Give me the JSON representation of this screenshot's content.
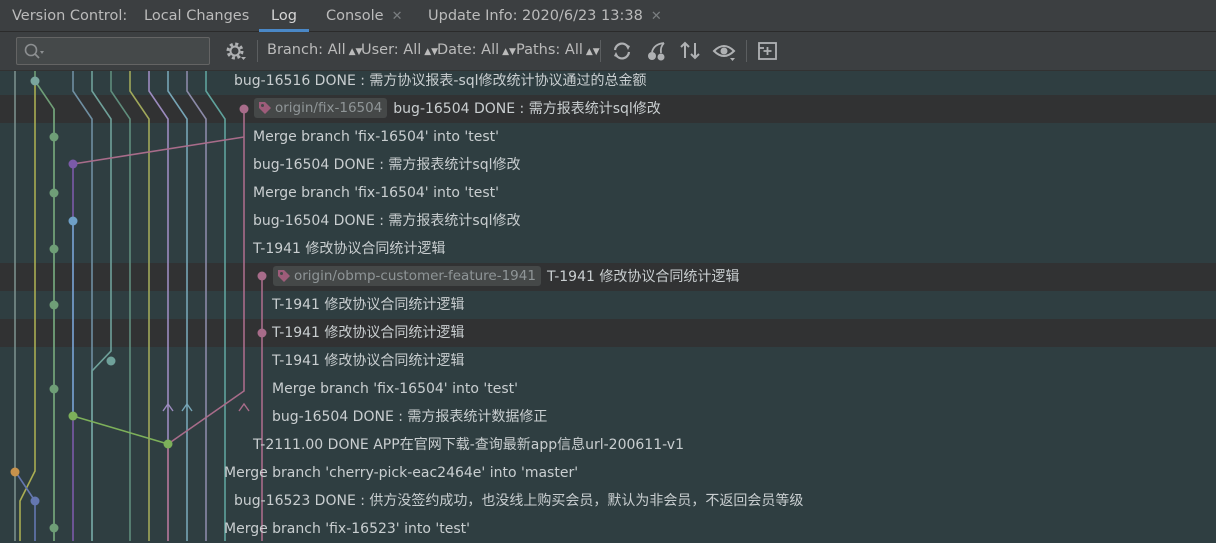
{
  "tabs": {
    "version_control": "Version Control:",
    "local_changes": "Local Changes",
    "log": "Log",
    "console": "Console",
    "update_info": "Update Info: 2020/6/23 13:38"
  },
  "toolbar": {
    "search_placeholder": "",
    "branch": "Branch: All",
    "user": "User: All",
    "date": "Date: All",
    "paths": "Paths: All"
  },
  "icons": [
    "search-icon",
    "settings-icon",
    "refresh-icon",
    "cherry-pick-icon",
    "sort-icon",
    "eye-icon",
    "new-tab-icon",
    "tag-icon"
  ],
  "colors": {
    "accent": "#4a88c7",
    "tag": "#9e5c7a"
  },
  "commits": [
    {
      "message": "bug-16516 DONE : 需方协议报表-sql修改统计协议通过的总金额",
      "ref": ""
    },
    {
      "message": "bug-16504 DONE : 需方报表统计sql修改",
      "ref": "origin/fix-16504"
    },
    {
      "message": "Merge branch 'fix-16504' into 'test'",
      "ref": ""
    },
    {
      "message": "bug-16504 DONE : 需方报表统计sql修改",
      "ref": ""
    },
    {
      "message": "Merge branch 'fix-16504' into 'test'",
      "ref": ""
    },
    {
      "message": "bug-16504 DONE : 需方报表统计sql修改",
      "ref": ""
    },
    {
      "message": "T-1941  修改协议合同统计逻辑",
      "ref": ""
    },
    {
      "message": "T-1941  修改协议合同统计逻辑",
      "ref": "origin/obmp-customer-feature-1941"
    },
    {
      "message": "T-1941  修改协议合同统计逻辑",
      "ref": ""
    },
    {
      "message": "T-1941  修改协议合同统计逻辑",
      "ref": ""
    },
    {
      "message": "T-1941  修改协议合同统计逻辑",
      "ref": ""
    },
    {
      "message": "Merge branch 'fix-16504' into 'test'",
      "ref": ""
    },
    {
      "message": "bug-16504 DONE : 需方报表统计数据修正",
      "ref": ""
    },
    {
      "message": "T-2111.00 DONE  APP在官网下载-查询最新app信息url-200611-v1",
      "ref": ""
    },
    {
      "message": "Merge branch 'cherry-pick-eac2464e' into 'master'",
      "ref": ""
    },
    {
      "message": "bug-16523 DONE : 供方没签约成功，也没线上购买会员，默认为非会员，不返回会员等级",
      "ref": ""
    },
    {
      "message": "Merge branch 'fix-16523' into 'test'",
      "ref": ""
    }
  ]
}
